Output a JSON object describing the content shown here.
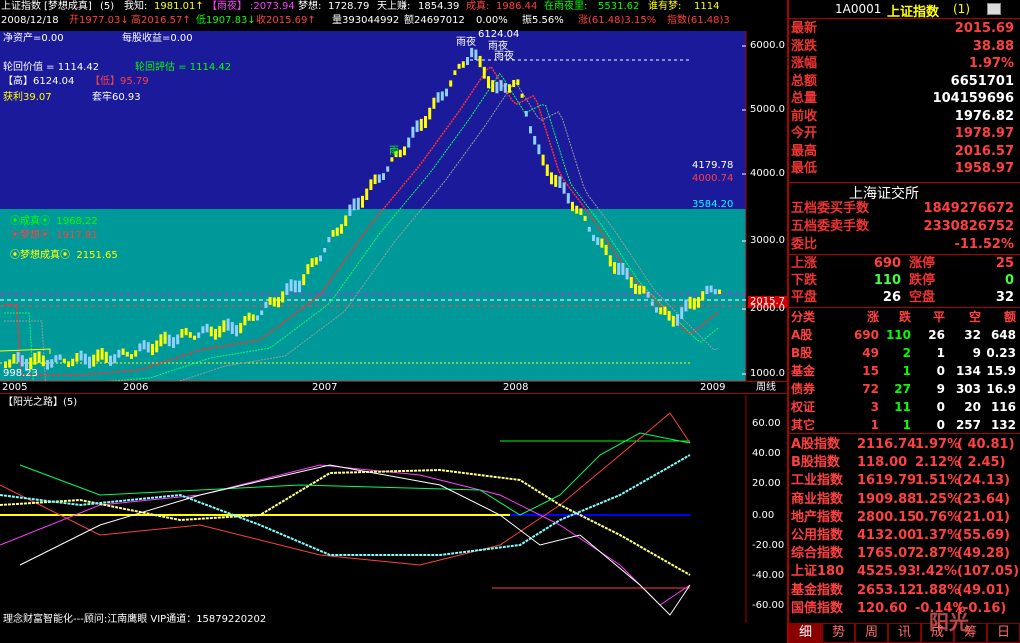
{
  "toolbar": {
    "title": "上证指数",
    "indicator": "[梦想成真]",
    "period": "(5)",
    "wozhi_l": "我知:",
    "wozhi_v": "1981.01↑",
    "yuye_tag": "【雨夜】",
    "yuye_v": ":2073.94",
    "mengxiang_l": "梦想:",
    "mengxiang_v": "1728.79",
    "tianshang_l": "天上赚:",
    "tianshang_v": "1854.39",
    "chengzhen_l": "成真:",
    "chengzhen_v": "1986.44",
    "zaiyu_l": "在雨夜里:",
    "zaiyu_v": "5531.62",
    "shui_l": "谁有梦:",
    "shui_v": "1114"
  },
  "infobar": {
    "date": "2008/12/18",
    "open": "开1977.03↓",
    "high": "高2016.57↑",
    "low": "低1907.83↓",
    "close": "收2015.69↑",
    "vol": "量393044992",
    "amt": "额24697012",
    "change": "0.00%",
    "swing": "振5.56%",
    "rise": "涨(61.48)3.15%",
    "idx": "指数(61.48)3"
  },
  "overlay": {
    "nav": "净资产=0.00",
    "eps": "每股收益=0.00",
    "lunhui": "轮回价值 = 1114.42",
    "lunhui2": "轮回評估 = 1114.42",
    "high": "【高】6124.04",
    "low": "【低】95.79",
    "profit": "获利39.07",
    "trap": "套牢60.93",
    "cz": "成真",
    "cz_v": "1968.22",
    "mx": "梦想",
    "mx_v": "1917.81",
    "mxcz": "梦想成真",
    "mxcz_v": "2151.65",
    "peak": "6124.04",
    "yuye_a": "雨夜",
    "yuye_b": "雨夜",
    "yuye_c": "雨夜",
    "you": "雨",
    "lv1": "4179.78",
    "lv2": "4000.74",
    "lv3": "3584.20",
    "bottom": "998.23",
    "cur": "2015.7"
  },
  "yaxis": [
    "6000.0",
    "5000.0",
    "4000.0",
    "3000.0",
    "2000.0",
    "1000.0"
  ],
  "xaxis": [
    "2005",
    "2006",
    "2007",
    "2008",
    "2009"
  ],
  "zhouxian": "周线",
  "sub": {
    "title": "【阳光之路】(5)",
    "yaxis": [
      "60.00",
      "40.00",
      "20.00",
      "0.00",
      "-20.00",
      "-40.00",
      "-60.00"
    ],
    "footer": "理念财富智能化---顾问:江南鹰眼 VIP通道：15879220202"
  },
  "quote": {
    "code": "1A0001",
    "name": "上证指数",
    "num": "(1)",
    "rows": [
      {
        "l": "最新",
        "v": "2015.69",
        "c": "up"
      },
      {
        "l": "涨跌",
        "v": "38.88",
        "c": "up"
      },
      {
        "l": "涨幅",
        "v": "1.97%",
        "c": "up"
      },
      {
        "l": "总额",
        "v": "6651701",
        "c": "wh"
      },
      {
        "l": "总量",
        "v": "104159696",
        "c": "wh"
      },
      {
        "l": "前收",
        "v": "1976.82",
        "c": "wh"
      },
      {
        "l": "今开",
        "v": "1978.97",
        "c": "up"
      },
      {
        "l": "最高",
        "v": "2016.57",
        "c": "up"
      },
      {
        "l": "最低",
        "v": "1958.97",
        "c": "up"
      }
    ],
    "exchange": "上海证交所",
    "buy_l": "五档委买手数",
    "buy_v": "1849276672",
    "sell_l": "五档委卖手数",
    "sell_v": "2330826752",
    "wb_l": "委比",
    "wb_v": "-11.52%",
    "up_l": "上涨",
    "up_v": "690",
    "zt_l": "涨停",
    "zt_v": "25",
    "down_l": "下跌",
    "down_v": "110",
    "dt_l": "跌停",
    "dt_v": "0",
    "flat_l": "平盘",
    "flat_v": "26",
    "kong_l": "空盘",
    "kong_v": "32"
  },
  "table": {
    "head": [
      "分类",
      "涨",
      "跌",
      "平",
      "空",
      "额"
    ],
    "rows": [
      [
        "A股",
        "690",
        "110",
        "26",
        "32",
        "648"
      ],
      [
        "B股",
        "49",
        "2",
        "1",
        "9",
        "0.23"
      ],
      [
        "基金",
        "15",
        "1",
        "0",
        "134",
        "15.9"
      ],
      [
        "债券",
        "72",
        "27",
        "9",
        "303",
        "16.9"
      ],
      [
        "权证",
        "3",
        "11",
        "0",
        "20",
        "116"
      ],
      [
        "其它",
        "1",
        "1",
        "0",
        "257",
        "132"
      ]
    ]
  },
  "indices": [
    {
      "n": "A股指数",
      "v": "2116.74",
      "p": "1.97%",
      "d": "( 40.81)"
    },
    {
      "n": "B股指数",
      "v": "118.00",
      "p": "2.12%",
      "d": "( 2.45)"
    },
    {
      "n": "工业指数",
      "v": "1619.79",
      "p": "1.51%",
      "d": "(24.13)"
    },
    {
      "n": "商业指数",
      "v": "1909.88",
      "p": "1.25%",
      "d": "(23.64)"
    },
    {
      "n": "地产指数",
      "v": "2800.15",
      "p": "0.76%",
      "d": "(21.01)"
    },
    {
      "n": "公用指数",
      "v": "4132.00",
      "p": "1.37%",
      "d": "(55.69)"
    },
    {
      "n": "综合指数",
      "v": "1765.07",
      "p": "2.87%",
      "d": "(49.28)"
    },
    {
      "n": "上证180",
      "v": "4525.93",
      "p": "!.42%",
      "d": "(107.05)"
    },
    {
      "n": "基金指数",
      "v": "2653.12",
      "p": "1.88%",
      "d": "(49.01)"
    },
    {
      "n": "国债指数",
      "v": "120.60",
      "p": "-0.14%",
      "d": "(-0.16)"
    }
  ],
  "tabs": [
    "细",
    "势",
    "周",
    "讯",
    "成",
    "筹",
    "日"
  ],
  "watermark": "阳光"
}
